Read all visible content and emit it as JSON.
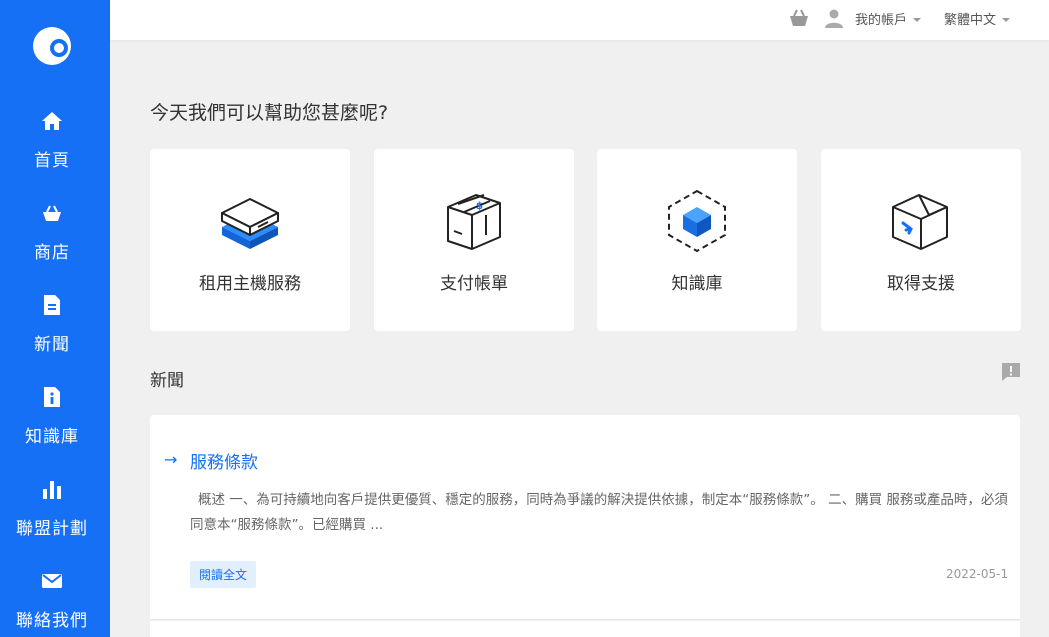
{
  "colors": {
    "brand": "#1570f5",
    "background": "#f0f0f0"
  },
  "sidebar": {
    "logo_icon": "brand-logo-icon",
    "items": [
      {
        "label": "首頁",
        "icon": "home-icon"
      },
      {
        "label": "商店",
        "icon": "basket-icon"
      },
      {
        "label": "新聞",
        "icon": "document-icon"
      },
      {
        "label": "知識庫",
        "icon": "info-document-icon"
      },
      {
        "label": "聯盟計劃",
        "icon": "bar-chart-icon"
      },
      {
        "label": "聯絡我們",
        "icon": "envelope-icon"
      }
    ]
  },
  "topbar": {
    "cart_icon": "cart-icon",
    "user_icon": "user-icon",
    "account_label": "我的帳戶",
    "language_label": "繁體中文"
  },
  "main": {
    "heading": "今天我們可以幫助您甚麼呢?",
    "cards": [
      {
        "label": "租用主機服務",
        "icon": "server-icon"
      },
      {
        "label": "支付帳單",
        "icon": "package-money-icon"
      },
      {
        "label": "知識庫",
        "icon": "cube-icon"
      },
      {
        "label": "取得支援",
        "icon": "open-box-icon"
      }
    ]
  },
  "news": {
    "title": "新聞",
    "feedback_icon": "feedback-icon",
    "articles": [
      {
        "title": "服務條款",
        "body": "概述 一、為可持續地向客戶提供更優質、穩定的服務，同時為爭議的解決提供依據，制定本“服務條款”。 二、購買 服務或產品時，必須同意本“服務條款”。已經購買 ...",
        "read_more": "閱讀全文",
        "date": "2022-05-1"
      }
    ]
  }
}
